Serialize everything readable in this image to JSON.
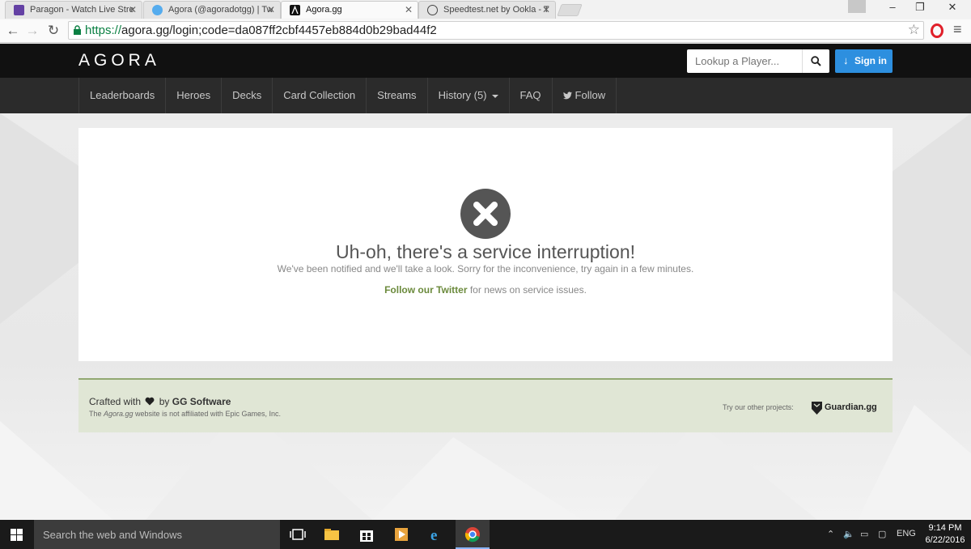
{
  "browser": {
    "tabs": [
      {
        "title": "Paragon - Watch Live Stre",
        "favicon": "twitch-icon",
        "color": "#6441a4"
      },
      {
        "title": "Agora (@agoradotgg) | Tw",
        "favicon": "twitter-icon",
        "color": "#55acee"
      },
      {
        "title": "Agora.gg",
        "favicon": "agora-icon",
        "color": "#111111"
      },
      {
        "title": "Speedtest.net by Ookla - T",
        "favicon": "speedometer-icon",
        "color": "#444444"
      }
    ],
    "url_scheme": "https://",
    "url_rest": "agora.gg/login;code=da087ff2cbf4457eb884d0b29bad44f2"
  },
  "site": {
    "logo": "AGORA",
    "search_placeholder": "Lookup a Player...",
    "signin_label": "Sign in",
    "brand_color": "#2d8fdf",
    "nav": [
      "Leaderboards",
      "Heroes",
      "Decks",
      "Card Collection",
      "Streams",
      "History (5)",
      "FAQ",
      "Follow"
    ]
  },
  "error": {
    "title": "Uh-oh, there's a service interruption!",
    "subtitle": "We've been notified and we'll take a look. Sorry for the inconvenience, try again in a few minutes.",
    "twitter_link": "Follow our Twitter",
    "twitter_suffix": " for news on service issues."
  },
  "footer": {
    "crafted_prefix": "Crafted with",
    "crafted_by": "by",
    "company": "GG Software",
    "disclaimer_prefix": "The ",
    "disclaimer_site": "Agora.gg",
    "disclaimer_suffix": " website is not affiliated with Epic Games, Inc.",
    "other_projects": "Try our other projects:",
    "guardian": "Guardian.gg"
  },
  "taskbar": {
    "search_text": "Search the web and Windows",
    "language": "ENG",
    "time": "9:14 PM",
    "date": "6/22/2016"
  }
}
